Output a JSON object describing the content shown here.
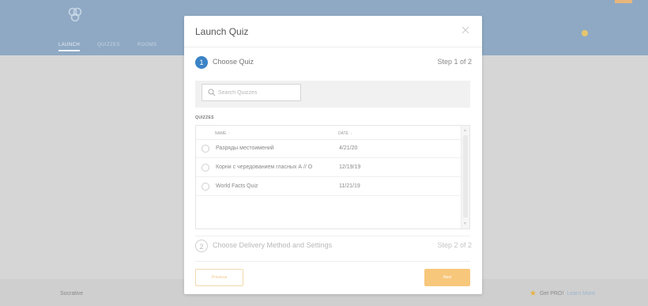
{
  "app": {
    "tabs": [
      "LAUNCH",
      "QUIZZES",
      "ROOMS"
    ],
    "footer_brand": "Socrative",
    "footer_pro": "Get PRO!",
    "footer_learn": "Learn More"
  },
  "modal": {
    "title": "Launch Quiz",
    "step1": {
      "number": "1",
      "label": "Choose Quiz",
      "count": "Step 1 of 2"
    },
    "step2": {
      "number": "2",
      "label": "Choose Delivery Method and Settings",
      "count": "Step 2 of 2"
    },
    "search": {
      "placeholder": "Search Quizzes"
    },
    "quizzes_label": "QUIZZES",
    "table": {
      "headers": {
        "name": "NAME",
        "name_sort": "↑",
        "date": "DATE",
        "date_sort": "↓"
      },
      "rows": [
        {
          "name": "Разряды местоимений",
          "date": "4/21/20"
        },
        {
          "name": "Корни с чередованием гласных А // О",
          "date": "12/19/19"
        },
        {
          "name": "World Facts Quiz",
          "date": "11/21/19"
        }
      ]
    },
    "buttons": {
      "previous": "Previous",
      "next": "Next"
    }
  },
  "colors": {
    "header_bg": "#8fa9c4",
    "step_active": "#3b83c6",
    "next_button": "#f7c77b",
    "previous_border": "#f1d8ad"
  },
  "icons": {
    "logo": "socrative-logo-icon",
    "close": "close-icon",
    "search": "search-icon",
    "star": "star-icon"
  }
}
